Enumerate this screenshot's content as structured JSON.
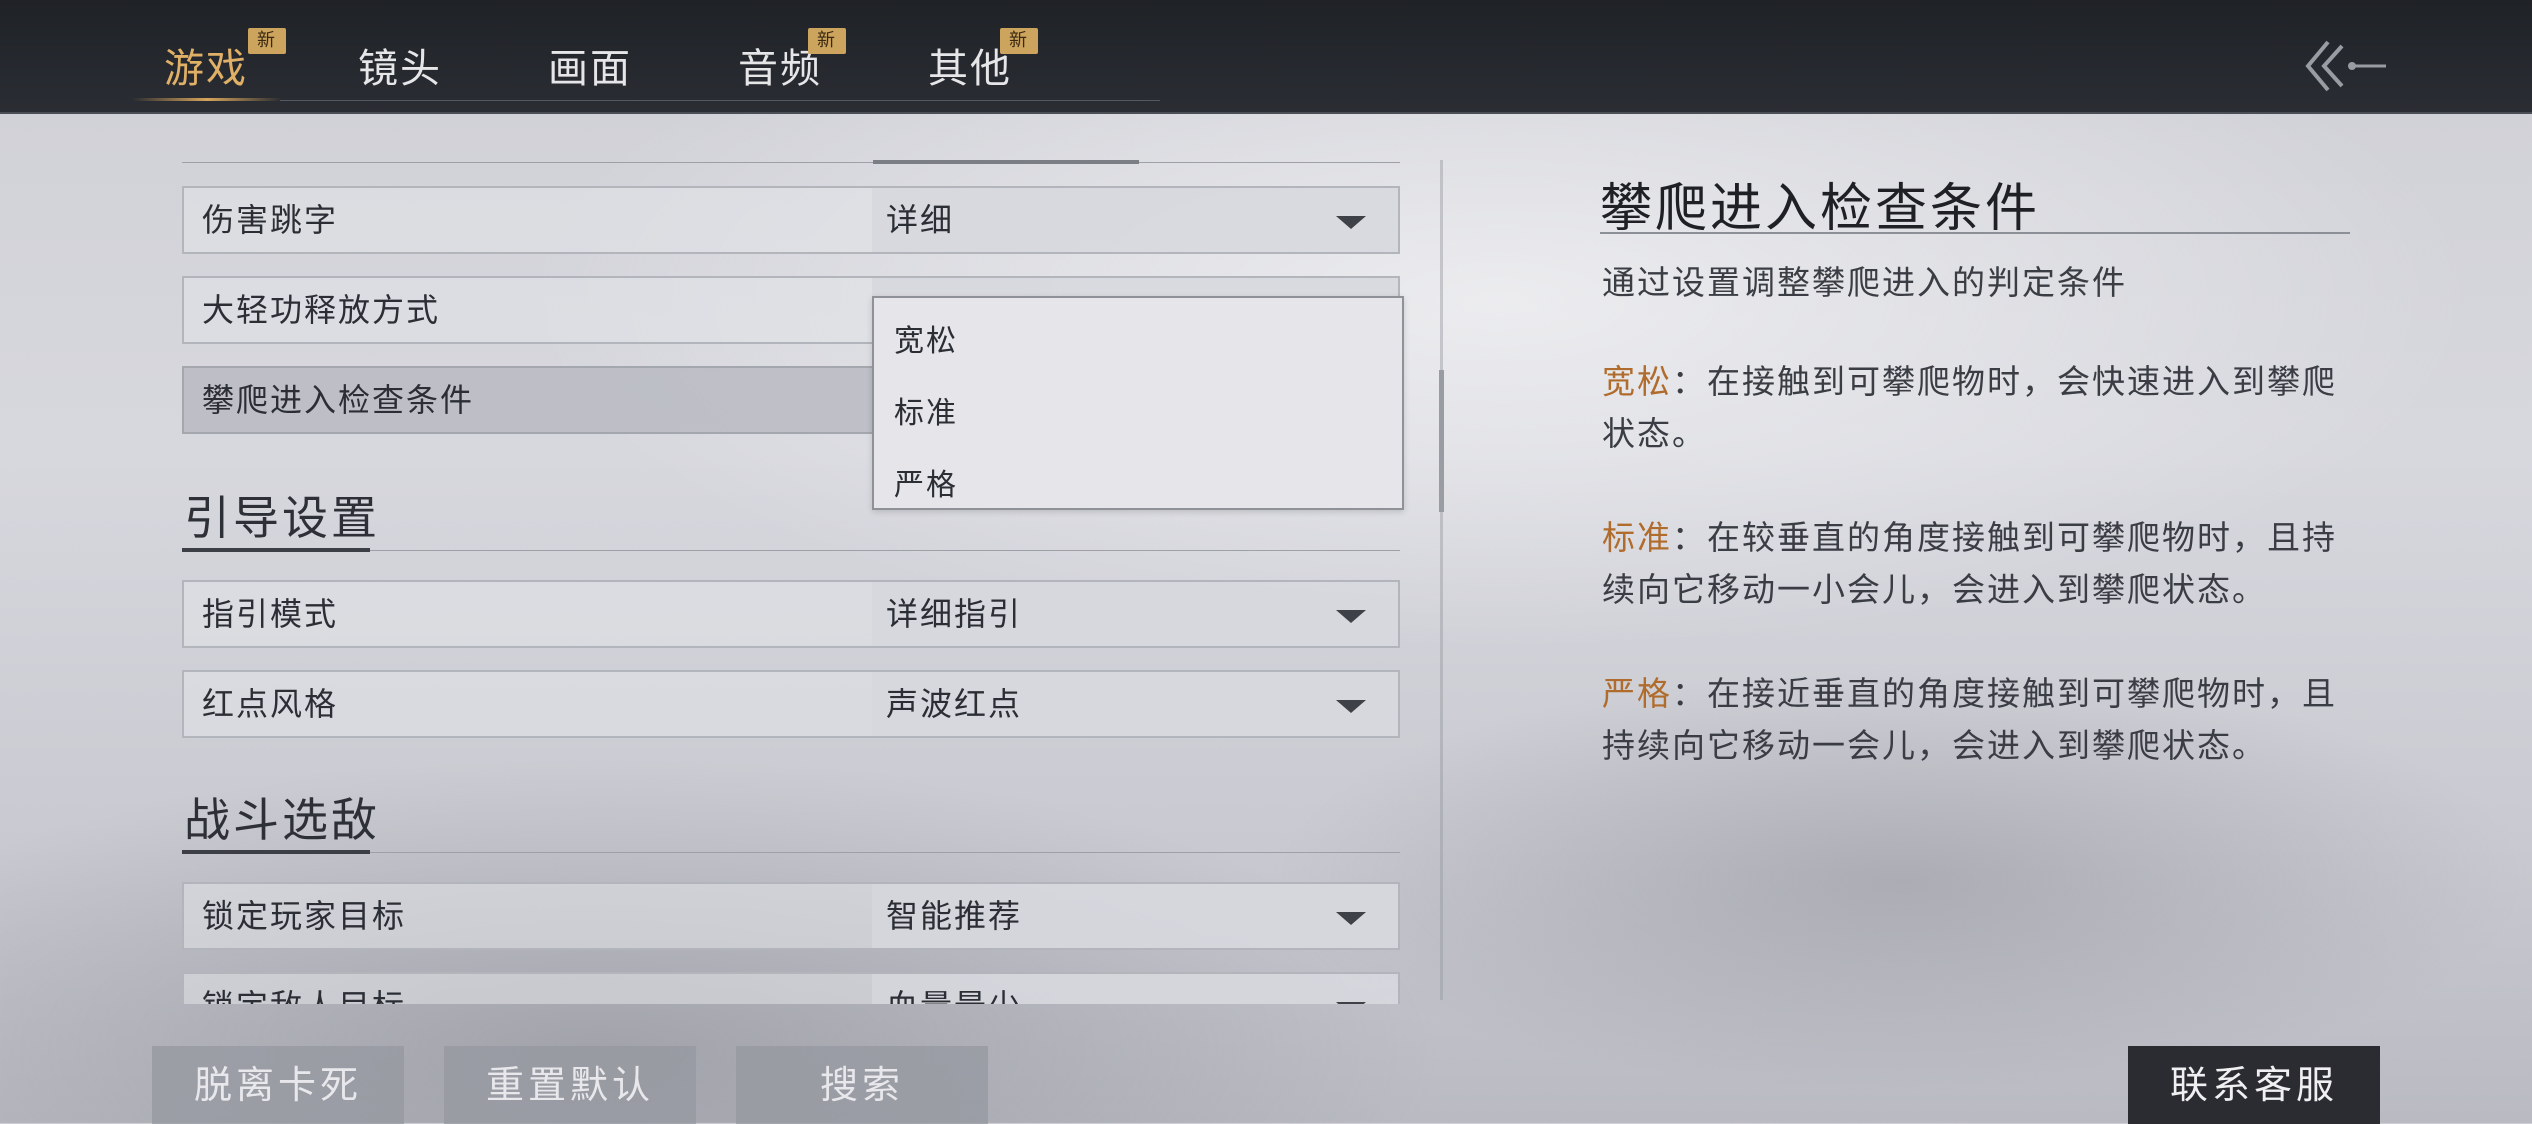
{
  "tabs": [
    {
      "label": "游戏",
      "active": true,
      "badge": "新"
    },
    {
      "label": "镜头",
      "active": false,
      "badge": ""
    },
    {
      "label": "画面",
      "active": false,
      "badge": ""
    },
    {
      "label": "音频",
      "active": false,
      "badge": "新"
    },
    {
      "label": "其他",
      "active": false,
      "badge": "新"
    }
  ],
  "back_icon": "double-chevron-left-icon",
  "settings": {
    "rows_top": [
      {
        "name": "伤害跳字",
        "value": "详细"
      },
      {
        "name": "大轻功释放方式",
        "value": ""
      },
      {
        "name": "攀爬进入检查条件",
        "value": ""
      }
    ],
    "section_guide": "引导设置",
    "rows_guide": [
      {
        "name": "指引模式",
        "value": "详细指引"
      },
      {
        "name": "红点风格",
        "value": "声波红点"
      }
    ],
    "section_combat": "战斗选敌",
    "rows_combat": [
      {
        "name": "锁定玩家目标",
        "value": "智能推荐"
      },
      {
        "name": "锁定敌人目标",
        "value": "血量最少"
      }
    ]
  },
  "dropdown": {
    "options": [
      "宽松",
      "标准",
      "严格"
    ]
  },
  "detail": {
    "title": "攀爬进入检查条件",
    "subtitle": "通过设置调整攀爬进入的判定条件",
    "items": [
      {
        "key": "宽松",
        "text": "：在接触到可攀爬物时，会快速进入到攀爬状态。"
      },
      {
        "key": "标准",
        "text": "：在较垂直的角度接触到可攀爬物时，且持续向它移动一小会儿，会进入到攀爬状态。"
      },
      {
        "key": "严格",
        "text": "：在接近垂直的角度接触到可攀爬物时，且持续向它移动一会儿，会进入到攀爬状态。"
      }
    ]
  },
  "buttons": {
    "unstuck": "脱离卡死",
    "reset": "重置默认",
    "search": "搜索",
    "contact": "联系客服"
  },
  "colors": {
    "accent": "#e0b067",
    "key": "#b06c2c",
    "topbar": "#23262b"
  }
}
